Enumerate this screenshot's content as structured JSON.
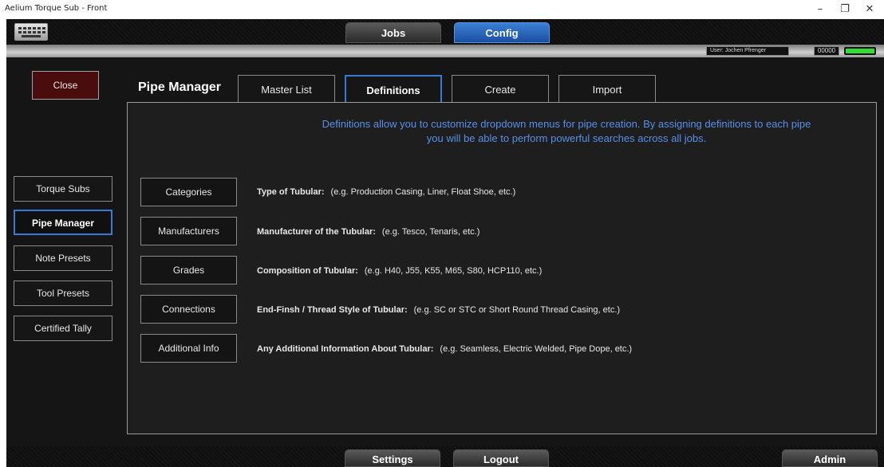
{
  "window": {
    "title": "Aelium Torque Sub - Front",
    "controls": {
      "minimize": "–",
      "restore": "❐",
      "close": "✕"
    }
  },
  "topbar": {
    "keyboard_icon": "keyboard-icon",
    "tabs": [
      {
        "label": "Jobs",
        "active": false
      },
      {
        "label": "Config",
        "active": true
      }
    ]
  },
  "status": {
    "user": "User: Jochen Pfrenger",
    "counter": "00000",
    "indicator_color": "#33dd33"
  },
  "sidebar": {
    "close_label": "Close",
    "items": [
      {
        "label": "Torque Subs",
        "active": false
      },
      {
        "label": "Pipe Manager",
        "active": true
      },
      {
        "label": "Note Presets",
        "active": false
      },
      {
        "label": "Tool Presets",
        "active": false
      },
      {
        "label": "Certified Tally",
        "active": false
      }
    ]
  },
  "pipe_manager": {
    "title": "Pipe Manager",
    "tabs": [
      {
        "label": "Master List",
        "active": false
      },
      {
        "label": "Definitions",
        "active": true
      },
      {
        "label": "Create",
        "active": false
      },
      {
        "label": "Import",
        "active": false
      }
    ],
    "intro": "Definitions allow you to customize dropdown menus for pipe creation. By assigning definitions to each pipe you will be able to perform powerful searches across all jobs.",
    "definitions": [
      {
        "button": "Categories",
        "heading": "Type of Tubular:",
        "example": "(e.g. Production Casing, Liner, Float Shoe, etc.)"
      },
      {
        "button": "Manufacturers",
        "heading": "Manufacturer of the Tubular:",
        "example": "(e.g. Tesco, Tenaris, etc.)"
      },
      {
        "button": "Grades",
        "heading": "Composition of Tubular:",
        "example": "(e.g. H40, J55, K55, M65, S80, HCP110, etc.)"
      },
      {
        "button": "Connections",
        "heading": "End-Finsh / Thread Style of Tubular:",
        "example": "(e.g. SC or STC or Short Round Thread Casing, etc.)"
      },
      {
        "button": "Additional Info",
        "heading": "Any Additional Information About Tubular:",
        "example": "(e.g. Seamless, Electric Welded, Pipe Dope, etc.)"
      }
    ]
  },
  "bottombar": {
    "settings": "Settings",
    "logout": "Logout",
    "admin": "Admin"
  },
  "colors": {
    "accent_blue": "#3a78d8",
    "intro_text": "#5a8fe8",
    "close_bg": "#4a0d0d"
  }
}
